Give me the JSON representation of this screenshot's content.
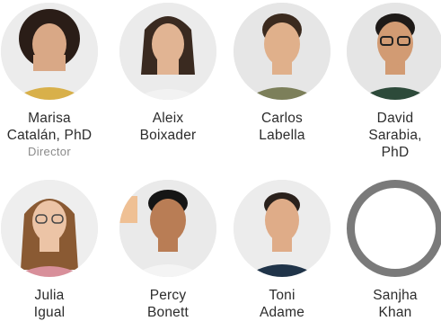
{
  "members": [
    {
      "name_line1": "Marisa",
      "name_line2": "Catalán, PhD",
      "name_line3": "",
      "role": "Director",
      "skin": "#d9a886",
      "hair": "#2a1d17",
      "shirt": "#d8b04a",
      "bg": "#ececec"
    },
    {
      "name_line1": "Aleix",
      "name_line2": "Boixader",
      "name_line3": "",
      "role": "",
      "skin": "#e1b493",
      "hair": "#3a2a20",
      "shirt": "#f2f2f2",
      "bg": "#ebebeb"
    },
    {
      "name_line1": "Carlos",
      "name_line2": "Labella",
      "name_line3": "",
      "role": "",
      "skin": "#e0b08b",
      "hair": "#3b2a1e",
      "shirt": "#7c7f5a",
      "bg": "#e6e6e6"
    },
    {
      "name_line1": "David",
      "name_line2": "Sarabia,",
      "name_line3": "PhD",
      "role": "",
      "skin": "#d29b73",
      "hair": "#1e1a18",
      "shirt": "#2d4a3a",
      "bg": "#e5e5e5"
    },
    {
      "name_line1": "Julia",
      "name_line2": "Igual",
      "name_line3": "",
      "role": "",
      "skin": "#ecc4a6",
      "hair": "#8a5a33",
      "shirt": "#d88f9a",
      "bg": "#eeeeee"
    },
    {
      "name_line1": "Percy",
      "name_line2": "Bonett",
      "name_line3": "",
      "role": "",
      "skin": "#b97d55",
      "hair": "#151515",
      "shirt": "#f4f4f4",
      "bg": "#eaeaea"
    },
    {
      "name_line1": "Toni",
      "name_line2": "Adame",
      "name_line3": "",
      "role": "",
      "skin": "#dfac88",
      "hair": "#2a211c",
      "shirt": "#203449",
      "bg": "#ececec"
    },
    {
      "name_line1": "Sanjha",
      "name_line2": "Khan",
      "name_line3": "",
      "role": "",
      "placeholder": true
    }
  ]
}
